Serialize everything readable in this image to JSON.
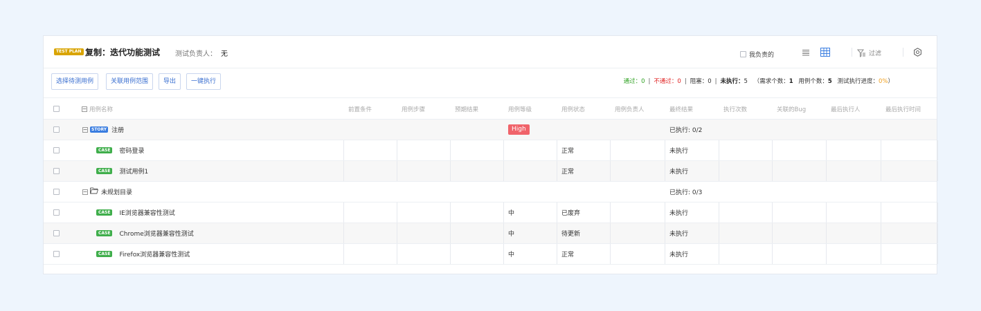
{
  "header": {
    "plan_badge": "TEST PLAN",
    "title": "复制：迭代功能测试",
    "owner_label": "测试负责人：",
    "owner_value": "无",
    "mine_label": "我负责的",
    "filter_label": "过滤",
    "icons": [
      "list-view-icon",
      "grid-view-icon",
      "filter-icon",
      "settings-icon"
    ]
  },
  "toolbar": {
    "buttons": [
      "选择待测用例",
      "关联用例范围",
      "导出",
      "一键执行"
    ],
    "stats": {
      "pass_label": "通过：",
      "pass": "0",
      "fail_label": "不通过：",
      "fail": "0",
      "block_label": "阻塞：",
      "block": "0",
      "notrun_label": "未执行：",
      "notrun": "5",
      "req_label": "需求个数：",
      "req": "1",
      "case_label": "用例个数：",
      "cases": "5",
      "progress_label": "测试执行进度：",
      "progress": "0%"
    },
    "colors": {
      "pass": "#2ea121",
      "fail": "#e02020",
      "progress": "#f0a020"
    }
  },
  "table": {
    "columns": [
      "用例名称",
      "前置条件",
      "用例步骤",
      "预期结果",
      "用例等级",
      "用例状态",
      "用例负责人",
      "最终结果",
      "执行次数",
      "关联的Bug",
      "最后执行人",
      "最后执行时间"
    ],
    "groups": [
      {
        "badge": "STORY",
        "name": "注册",
        "level": "High",
        "summary": "已执行: 0/2",
        "cases": [
          {
            "badge": "CASE",
            "name": "密码登录",
            "level": "",
            "status": "正常",
            "result": "未执行"
          },
          {
            "badge": "CASE",
            "name": "测试用例1",
            "level": "",
            "status": "正常",
            "result": "未执行"
          }
        ]
      },
      {
        "badge": "",
        "name": "未规划目录",
        "level": "",
        "summary": "已执行: 0/3",
        "cases": [
          {
            "badge": "CASE",
            "name": "IE浏览器兼容性测试",
            "level": "中",
            "status": "已废弃",
            "result": "未执行"
          },
          {
            "badge": "CASE",
            "name": "Chrome浏览器兼容性测试",
            "level": "中",
            "status": "待更新",
            "result": "未执行"
          },
          {
            "badge": "CASE",
            "name": "Firefox浏览器兼容性测试",
            "level": "中",
            "status": "正常",
            "result": "未执行"
          }
        ]
      }
    ]
  }
}
